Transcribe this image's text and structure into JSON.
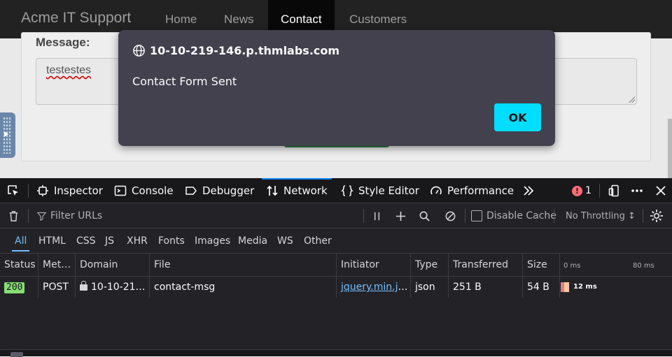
{
  "site": {
    "brand": "Acme IT Support",
    "nav": [
      {
        "label": "Home",
        "active": false
      },
      {
        "label": "News",
        "active": false
      },
      {
        "label": "Contact",
        "active": true
      },
      {
        "label": "Customers",
        "active": false
      }
    ],
    "message_label": "Message:",
    "message_value": "testestes"
  },
  "dialog": {
    "origin": "10-10-219-146.p.thmlabs.com",
    "message": "Contact Form Sent",
    "ok_label": "OK",
    "ok_color": "#00ddff"
  },
  "devtools": {
    "tabs": [
      {
        "label": "Inspector",
        "icon": "inspector-icon"
      },
      {
        "label": "Console",
        "icon": "console-icon"
      },
      {
        "label": "Debugger",
        "icon": "debugger-icon"
      },
      {
        "label": "Network",
        "icon": "network-icon",
        "active": true
      },
      {
        "label": "Style Editor",
        "icon": "style-editor-icon"
      },
      {
        "label": "Performance",
        "icon": "performance-icon"
      }
    ],
    "error_count": "1",
    "filter_placeholder": "Filter URLs",
    "disable_cache_label": "Disable Cache",
    "throttling_label": "No Throttling ↕",
    "type_filters": [
      "All",
      "HTML",
      "CSS",
      "JS",
      "XHR",
      "Fonts",
      "Images",
      "Media",
      "WS",
      "Other"
    ],
    "active_type_filter": "All",
    "columns": [
      "Status",
      "Met…",
      "Domain",
      "File",
      "Initiator",
      "Type",
      "Transferred",
      "Size"
    ],
    "waterfall_labels": [
      "0 ms",
      "80 ms"
    ],
    "requests": [
      {
        "status": "200",
        "method": "POST",
        "domain": "10-10-21…",
        "file": "contact-msg",
        "initiator": "jquery.min.js…",
        "type": "json",
        "transferred": "251 B",
        "size": "54 B",
        "timing": "12 ms"
      }
    ],
    "accent_color": "#0a84ff",
    "status_ok_color": "#86de74"
  }
}
